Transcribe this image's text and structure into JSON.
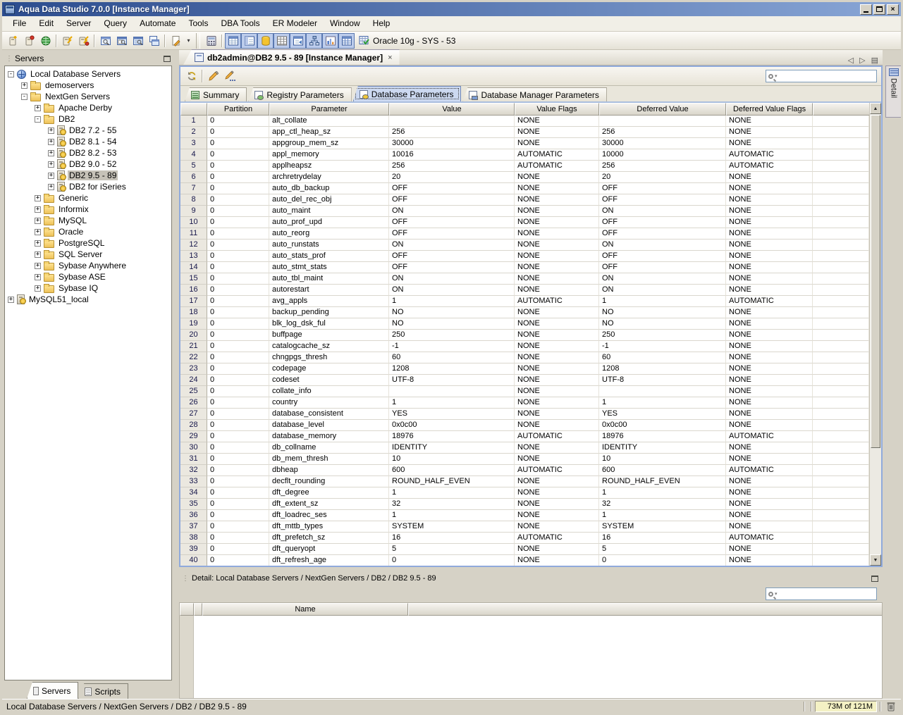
{
  "window": {
    "title": "Aqua Data Studio 7.0.0 [Instance Manager]"
  },
  "icons": {
    "close": "×",
    "dropdown": "▾",
    "search_caret": "▾",
    "nav_prev": "◁",
    "nav_next": "▷",
    "menu_list": "▤",
    "grip": "⋮",
    "scroll_up": "▲",
    "scroll_down": "▼"
  },
  "menu": {
    "items": [
      "File",
      "Edit",
      "Server",
      "Query",
      "Automate",
      "Tools",
      "DBA Tools",
      "ER Modeler",
      "Window",
      "Help"
    ]
  },
  "toolbar": {
    "button_names": [
      "register-server",
      "unregister-server",
      "connect-server",
      "attach-server",
      "detach-server",
      "schema-browser",
      "query-analyzer",
      "query-builder",
      "table-browser",
      "new-file",
      "instance-manager",
      "view-toggle-grid",
      "view-toggle-form",
      "view-toggle-storage",
      "view-toggle-table",
      "view-toggle-schedule",
      "view-toggle-topology",
      "view-toggle-chart",
      "view-toggle-list"
    ],
    "connection_label": "Oracle 10g - SYS - 53"
  },
  "sidebar": {
    "title": "Servers",
    "tree": [
      {
        "label": "Local Database Servers",
        "depth": 0,
        "expander": "-",
        "icon": "globe",
        "selected": false
      },
      {
        "label": "demoservers",
        "depth": 1,
        "expander": "+",
        "icon": "folder",
        "selected": false
      },
      {
        "label": "NextGen Servers",
        "depth": 1,
        "expander": "-",
        "icon": "folder",
        "selected": false
      },
      {
        "label": "Apache Derby",
        "depth": 2,
        "expander": "+",
        "icon": "folder",
        "selected": false
      },
      {
        "label": "DB2",
        "depth": 2,
        "expander": "-",
        "icon": "folder",
        "selected": false
      },
      {
        "label": "DB2 7.2 - 55",
        "depth": 3,
        "expander": "+",
        "icon": "server",
        "selected": false
      },
      {
        "label": "DB2 8.1 - 54",
        "depth": 3,
        "expander": "+",
        "icon": "server",
        "selected": false
      },
      {
        "label": "DB2 8.2 - 53",
        "depth": 3,
        "expander": "+",
        "icon": "server",
        "selected": false
      },
      {
        "label": "DB2 9.0 - 52",
        "depth": 3,
        "expander": "+",
        "icon": "server",
        "selected": false
      },
      {
        "label": "DB2 9.5 - 89",
        "depth": 3,
        "expander": "+",
        "icon": "server",
        "selected": true
      },
      {
        "label": "DB2 for iSeries",
        "depth": 3,
        "expander": "+",
        "icon": "server",
        "selected": false
      },
      {
        "label": "Generic",
        "depth": 2,
        "expander": "+",
        "icon": "folder",
        "selected": false
      },
      {
        "label": "Informix",
        "depth": 2,
        "expander": "+",
        "icon": "folder",
        "selected": false
      },
      {
        "label": "MySQL",
        "depth": 2,
        "expander": "+",
        "icon": "folder",
        "selected": false
      },
      {
        "label": "Oracle",
        "depth": 2,
        "expander": "+",
        "icon": "folder",
        "selected": false
      },
      {
        "label": "PostgreSQL",
        "depth": 2,
        "expander": "+",
        "icon": "folder",
        "selected": false
      },
      {
        "label": "SQL Server",
        "depth": 2,
        "expander": "+",
        "icon": "folder",
        "selected": false
      },
      {
        "label": "Sybase Anywhere",
        "depth": 2,
        "expander": "+",
        "icon": "folder",
        "selected": false
      },
      {
        "label": "Sybase ASE",
        "depth": 2,
        "expander": "+",
        "icon": "folder",
        "selected": false
      },
      {
        "label": "Sybase IQ",
        "depth": 2,
        "expander": "+",
        "icon": "folder",
        "selected": false
      },
      {
        "label": "MySQL51_local",
        "depth": 0,
        "expander": "+",
        "icon": "server",
        "selected": false
      }
    ],
    "tabs": [
      {
        "label": "Servers",
        "active": true,
        "icon": "server"
      },
      {
        "label": "Scripts",
        "active": false,
        "icon": "script"
      }
    ]
  },
  "document": {
    "tab_title": "db2admin@DB2 9.5 - 89 [Instance Manager]",
    "inner_toolbar_names": [
      "refresh",
      "edit-parameter",
      "edit-parameter-extended"
    ],
    "subtabs": [
      {
        "label": "Summary",
        "active": false,
        "icon": "grid"
      },
      {
        "label": "Registry Parameters",
        "active": false,
        "icon": "doc-green"
      },
      {
        "label": "Database Parameters",
        "active": true,
        "icon": "doc-yellow"
      },
      {
        "label": "Database Manager Parameters",
        "active": false,
        "icon": "doc-blue"
      }
    ],
    "search_value": ""
  },
  "grid": {
    "columns": [
      "",
      "Partition",
      "Parameter",
      "Value",
      "Value Flags",
      "Deferred Value",
      "Deferred Value Flags"
    ],
    "rows": [
      [
        "1",
        "0",
        "alt_collate",
        "",
        "NONE",
        "",
        "NONE"
      ],
      [
        "2",
        "0",
        "app_ctl_heap_sz",
        "256",
        "NONE",
        "256",
        "NONE"
      ],
      [
        "3",
        "0",
        "appgroup_mem_sz",
        "30000",
        "NONE",
        "30000",
        "NONE"
      ],
      [
        "4",
        "0",
        "appl_memory",
        "10016",
        "AUTOMATIC",
        "10000",
        "AUTOMATIC"
      ],
      [
        "5",
        "0",
        "applheapsz",
        "256",
        "AUTOMATIC",
        "256",
        "AUTOMATIC"
      ],
      [
        "6",
        "0",
        "archretrydelay",
        "20",
        "NONE",
        "20",
        "NONE"
      ],
      [
        "7",
        "0",
        "auto_db_backup",
        "OFF",
        "NONE",
        "OFF",
        "NONE"
      ],
      [
        "8",
        "0",
        "auto_del_rec_obj",
        "OFF",
        "NONE",
        "OFF",
        "NONE"
      ],
      [
        "9",
        "0",
        "auto_maint",
        "ON",
        "NONE",
        "ON",
        "NONE"
      ],
      [
        "10",
        "0",
        "auto_prof_upd",
        "OFF",
        "NONE",
        "OFF",
        "NONE"
      ],
      [
        "11",
        "0",
        "auto_reorg",
        "OFF",
        "NONE",
        "OFF",
        "NONE"
      ],
      [
        "12",
        "0",
        "auto_runstats",
        "ON",
        "NONE",
        "ON",
        "NONE"
      ],
      [
        "13",
        "0",
        "auto_stats_prof",
        "OFF",
        "NONE",
        "OFF",
        "NONE"
      ],
      [
        "14",
        "0",
        "auto_stmt_stats",
        "OFF",
        "NONE",
        "OFF",
        "NONE"
      ],
      [
        "15",
        "0",
        "auto_tbl_maint",
        "ON",
        "NONE",
        "ON",
        "NONE"
      ],
      [
        "16",
        "0",
        "autorestart",
        "ON",
        "NONE",
        "ON",
        "NONE"
      ],
      [
        "17",
        "0",
        "avg_appls",
        "1",
        "AUTOMATIC",
        "1",
        "AUTOMATIC"
      ],
      [
        "18",
        "0",
        "backup_pending",
        "NO",
        "NONE",
        "NO",
        "NONE"
      ],
      [
        "19",
        "0",
        "blk_log_dsk_ful",
        "NO",
        "NONE",
        "NO",
        "NONE"
      ],
      [
        "20",
        "0",
        "buffpage",
        "250",
        "NONE",
        "250",
        "NONE"
      ],
      [
        "21",
        "0",
        "catalogcache_sz",
        "-1",
        "NONE",
        "-1",
        "NONE"
      ],
      [
        "22",
        "0",
        "chngpgs_thresh",
        "60",
        "NONE",
        "60",
        "NONE"
      ],
      [
        "23",
        "0",
        "codepage",
        "1208",
        "NONE",
        "1208",
        "NONE"
      ],
      [
        "24",
        "0",
        "codeset",
        "UTF-8",
        "NONE",
        "UTF-8",
        "NONE"
      ],
      [
        "25",
        "0",
        "collate_info",
        "",
        "NONE",
        "",
        "NONE"
      ],
      [
        "26",
        "0",
        "country",
        "1",
        "NONE",
        "1",
        "NONE"
      ],
      [
        "27",
        "0",
        "database_consistent",
        "YES",
        "NONE",
        "YES",
        "NONE"
      ],
      [
        "28",
        "0",
        "database_level",
        "0x0c00",
        "NONE",
        "0x0c00",
        "NONE"
      ],
      [
        "29",
        "0",
        "database_memory",
        "18976",
        "AUTOMATIC",
        "18976",
        "AUTOMATIC"
      ],
      [
        "30",
        "0",
        "db_collname",
        "IDENTITY",
        "NONE",
        "IDENTITY",
        "NONE"
      ],
      [
        "31",
        "0",
        "db_mem_thresh",
        "10",
        "NONE",
        "10",
        "NONE"
      ],
      [
        "32",
        "0",
        "dbheap",
        "600",
        "AUTOMATIC",
        "600",
        "AUTOMATIC"
      ],
      [
        "33",
        "0",
        "decflt_rounding",
        "ROUND_HALF_EVEN",
        "NONE",
        "ROUND_HALF_EVEN",
        "NONE"
      ],
      [
        "34",
        "0",
        "dft_degree",
        "1",
        "NONE",
        "1",
        "NONE"
      ],
      [
        "35",
        "0",
        "dft_extent_sz",
        "32",
        "NONE",
        "32",
        "NONE"
      ],
      [
        "36",
        "0",
        "dft_loadrec_ses",
        "1",
        "NONE",
        "1",
        "NONE"
      ],
      [
        "37",
        "0",
        "dft_mttb_types",
        "SYSTEM",
        "NONE",
        "SYSTEM",
        "NONE"
      ],
      [
        "38",
        "0",
        "dft_prefetch_sz",
        "16",
        "AUTOMATIC",
        "16",
        "AUTOMATIC"
      ],
      [
        "39",
        "0",
        "dft_queryopt",
        "5",
        "NONE",
        "5",
        "NONE"
      ],
      [
        "40",
        "0",
        "dft_refresh_age",
        "0",
        "NONE",
        "0",
        "NONE"
      ]
    ]
  },
  "detail": {
    "title": "Detail: Local Database Servers / NextGen Servers / DB2 / DB2 9.5 - 89",
    "name_column": "Name",
    "tab_label": "Detail",
    "search_value": ""
  },
  "statusbar": {
    "path": "Local Database Servers / NextGen Servers / DB2 / DB2 9.5 - 89",
    "memory": "73M of 121M"
  }
}
